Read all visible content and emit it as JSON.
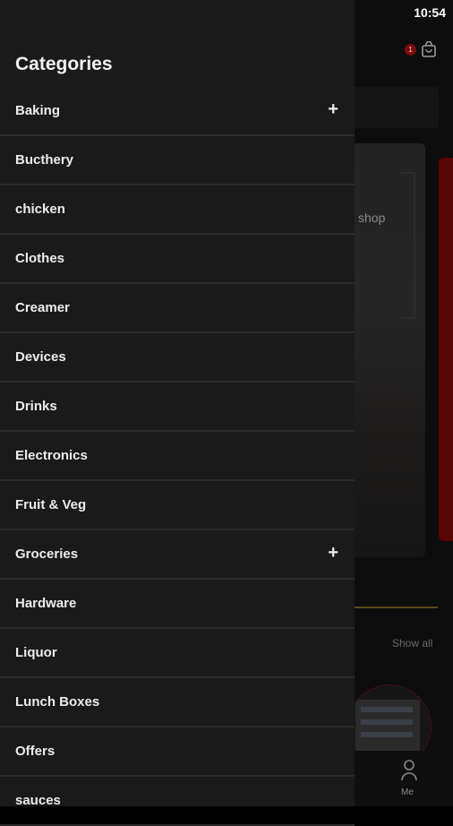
{
  "status_bar": {
    "time": "10:54"
  },
  "background": {
    "cart_badge_count": "1",
    "banner_text": "shop",
    "show_all": "Show all",
    "bottom_nav": {
      "me_label": "Me"
    }
  },
  "drawer": {
    "title": "Categories",
    "items": [
      {
        "label": "Baking",
        "expandable": true
      },
      {
        "label": "Bucthery",
        "expandable": false
      },
      {
        "label": "chicken",
        "expandable": false
      },
      {
        "label": "Clothes",
        "expandable": false
      },
      {
        "label": "Creamer",
        "expandable": false
      },
      {
        "label": "Devices",
        "expandable": false
      },
      {
        "label": "Drinks",
        "expandable": false
      },
      {
        "label": "Electronics",
        "expandable": false
      },
      {
        "label": "Fruit & Veg",
        "expandable": false
      },
      {
        "label": "Groceries",
        "expandable": true
      },
      {
        "label": "Hardware",
        "expandable": false
      },
      {
        "label": "Liquor",
        "expandable": false
      },
      {
        "label": "Lunch Boxes",
        "expandable": false
      },
      {
        "label": "Offers",
        "expandable": false
      },
      {
        "label": "sauces",
        "expandable": false
      }
    ],
    "expand_symbol": "+"
  }
}
